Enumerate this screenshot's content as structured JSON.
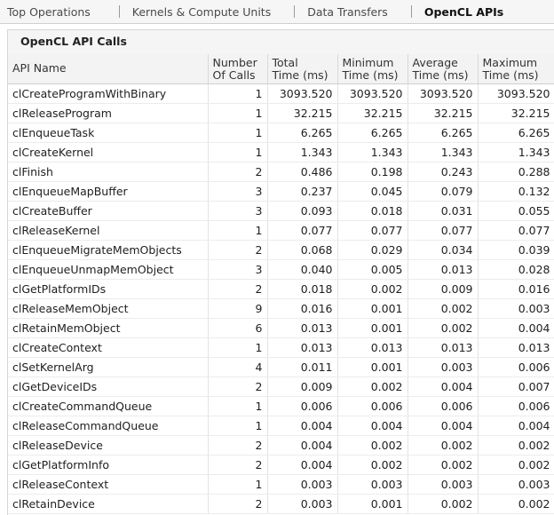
{
  "tabs": [
    "Top Operations",
    "Kernels & Compute Units",
    "Data Transfers",
    "OpenCL APIs"
  ],
  "panel_title": "OpenCL API Calls",
  "columns": [
    [
      "API Name"
    ],
    [
      "Number",
      "Of Calls"
    ],
    [
      "Total",
      "Time (ms)"
    ],
    [
      "Minimum",
      "Time (ms)"
    ],
    [
      "Average",
      "Time (ms)"
    ],
    [
      "Maximum",
      "Time (ms)"
    ]
  ],
  "rows": [
    [
      "clCreateProgramWithBinary",
      "1",
      "3093.520",
      "3093.520",
      "3093.520",
      "3093.520"
    ],
    [
      "clReleaseProgram",
      "1",
      "32.215",
      "32.215",
      "32.215",
      "32.215"
    ],
    [
      "clEnqueueTask",
      "1",
      "6.265",
      "6.265",
      "6.265",
      "6.265"
    ],
    [
      "clCreateKernel",
      "1",
      "1.343",
      "1.343",
      "1.343",
      "1.343"
    ],
    [
      "clFinish",
      "2",
      "0.486",
      "0.198",
      "0.243",
      "0.288"
    ],
    [
      "clEnqueueMapBuffer",
      "3",
      "0.237",
      "0.045",
      "0.079",
      "0.132"
    ],
    [
      "clCreateBuffer",
      "3",
      "0.093",
      "0.018",
      "0.031",
      "0.055"
    ],
    [
      "clReleaseKernel",
      "1",
      "0.077",
      "0.077",
      "0.077",
      "0.077"
    ],
    [
      "clEnqueueMigrateMemObjects",
      "2",
      "0.068",
      "0.029",
      "0.034",
      "0.039"
    ],
    [
      "clEnqueueUnmapMemObject",
      "3",
      "0.040",
      "0.005",
      "0.013",
      "0.028"
    ],
    [
      "clGetPlatformIDs",
      "2",
      "0.018",
      "0.002",
      "0.009",
      "0.016"
    ],
    [
      "clReleaseMemObject",
      "9",
      "0.016",
      "0.001",
      "0.002",
      "0.003"
    ],
    [
      "clRetainMemObject",
      "6",
      "0.013",
      "0.001",
      "0.002",
      "0.004"
    ],
    [
      "clCreateContext",
      "1",
      "0.013",
      "0.013",
      "0.013",
      "0.013"
    ],
    [
      "clSetKernelArg",
      "4",
      "0.011",
      "0.001",
      "0.003",
      "0.006"
    ],
    [
      "clGetDeviceIDs",
      "2",
      "0.009",
      "0.002",
      "0.004",
      "0.007"
    ],
    [
      "clCreateCommandQueue",
      "1",
      "0.006",
      "0.006",
      "0.006",
      "0.006"
    ],
    [
      "clReleaseCommandQueue",
      "1",
      "0.004",
      "0.004",
      "0.004",
      "0.004"
    ],
    [
      "clReleaseDevice",
      "2",
      "0.004",
      "0.002",
      "0.002",
      "0.002"
    ],
    [
      "clGetPlatformInfo",
      "2",
      "0.004",
      "0.002",
      "0.002",
      "0.002"
    ],
    [
      "clReleaseContext",
      "1",
      "0.003",
      "0.003",
      "0.003",
      "0.003"
    ],
    [
      "clRetainDevice",
      "2",
      "0.003",
      "0.001",
      "0.002",
      "0.002"
    ]
  ]
}
